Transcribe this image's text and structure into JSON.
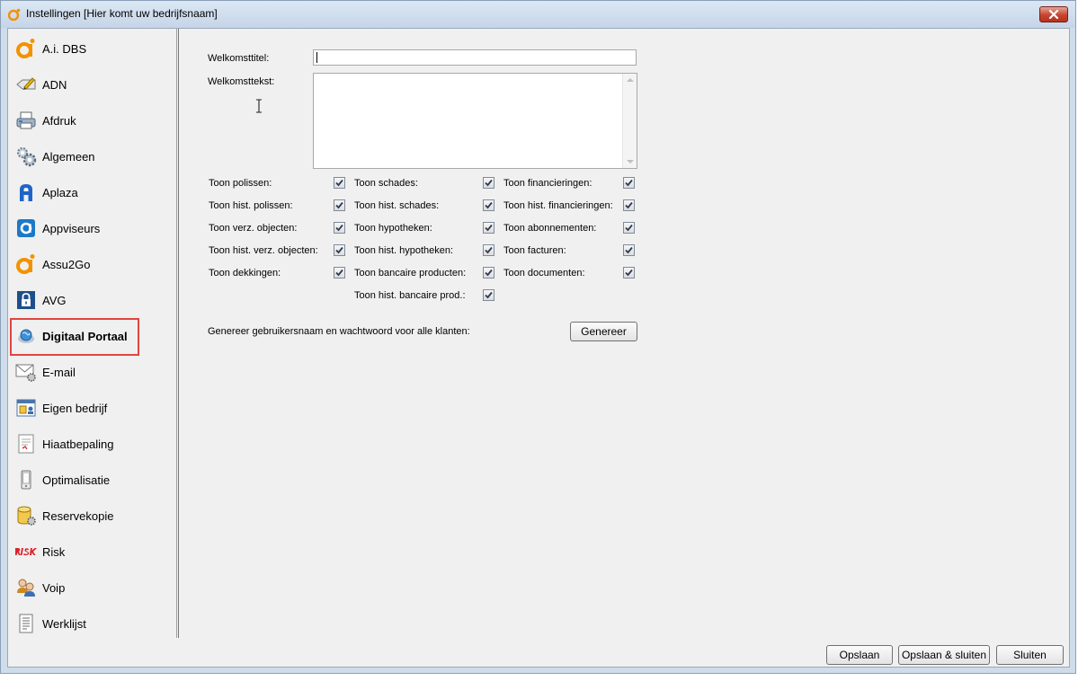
{
  "window": {
    "title": "Instellingen [Hier komt uw bedrijfsnaam]"
  },
  "sidebar": {
    "selected": "Digitaal Portaal",
    "items": [
      {
        "label": "A.i. DBS",
        "icon": "ai-logo-icon"
      },
      {
        "label": "ADN",
        "icon": "pencil-card-icon"
      },
      {
        "label": "Afdruk",
        "icon": "printer-icon"
      },
      {
        "label": "Algemeen",
        "icon": "gears-icon"
      },
      {
        "label": "Aplaza",
        "icon": "aplaza-logo-icon"
      },
      {
        "label": "Appviseurs",
        "icon": "appviseurs-logo-icon"
      },
      {
        "label": "Assu2Go",
        "icon": "assu2go-logo-icon"
      },
      {
        "label": "AVG",
        "icon": "lock-icon"
      },
      {
        "label": "Digitaal Portaal",
        "icon": "globe-icon"
      },
      {
        "label": "E-mail",
        "icon": "envelope-gear-icon"
      },
      {
        "label": "Eigen bedrijf",
        "icon": "company-window-icon"
      },
      {
        "label": "Hiaatbepaling",
        "icon": "document-icon"
      },
      {
        "label": "Optimalisatie",
        "icon": "phone-device-icon"
      },
      {
        "label": "Reservekopie",
        "icon": "database-gear-icon"
      },
      {
        "label": "Risk",
        "icon": "risk-logo-icon"
      },
      {
        "label": "Voip",
        "icon": "users-icon"
      },
      {
        "label": "Werklijst",
        "icon": "list-document-icon"
      }
    ]
  },
  "form": {
    "welkomsttitel_label": "Welkomsttitel:",
    "welkomsttitel_value": "",
    "welkomsttekst_label": "Welkomsttekst:",
    "welkomsttekst_value": "",
    "checkbox_columns": [
      [
        {
          "label": "Toon polissen:",
          "checked": true
        },
        {
          "label": "Toon hist. polissen:",
          "checked": true
        },
        {
          "label": "Toon verz. objecten:",
          "checked": true
        },
        {
          "label": "Toon hist. verz. objecten:",
          "checked": true
        },
        {
          "label": "Toon dekkingen:",
          "checked": true
        }
      ],
      [
        {
          "label": "Toon schades:",
          "checked": true
        },
        {
          "label": "Toon hist. schades:",
          "checked": true
        },
        {
          "label": "Toon hypotheken:",
          "checked": true
        },
        {
          "label": "Toon hist. hypotheken:",
          "checked": true
        },
        {
          "label": "Toon bancaire producten:",
          "checked": true
        },
        {
          "label": "Toon hist. bancaire prod.:",
          "checked": true
        }
      ],
      [
        {
          "label": "Toon financieringen:",
          "checked": true
        },
        {
          "label": "Toon hist. financieringen:",
          "checked": true
        },
        {
          "label": "Toon abonnementen:",
          "checked": true
        },
        {
          "label": "Toon facturen:",
          "checked": true
        },
        {
          "label": "Toon documenten:",
          "checked": true
        }
      ]
    ],
    "generate_label": "Genereer gebruikersnaam en wachtwoord voor alle klanten:",
    "generate_button": "Genereer"
  },
  "footer": {
    "save": "Opslaan",
    "save_close": "Opslaan & sluiten",
    "close": "Sluiten"
  },
  "colors": {
    "selection_border": "#e0453f",
    "brand_orange": "#f39200",
    "aplaza_blue": "#1e64c8"
  }
}
